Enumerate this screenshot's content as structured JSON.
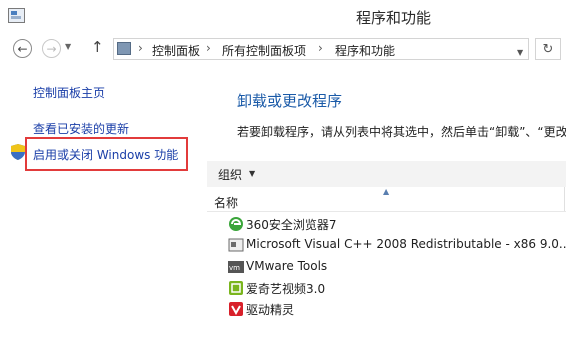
{
  "window": {
    "title": "程序和功能"
  },
  "nav": {
    "breadcrumbs": [
      "控制面板",
      "所有控制面板项",
      "程序和功能"
    ]
  },
  "left": {
    "home": "控制面板主页",
    "updates": "查看已安装的更新",
    "features": "启用或关闭 Windows 功能"
  },
  "main": {
    "title": "卸载或更改程序",
    "description": "若要卸载程序，请从列表中将其选中，然后单击“卸载”、“更改”"
  },
  "toolbar": {
    "organize": "组织"
  },
  "list": {
    "column_name": "名称",
    "items": [
      {
        "name": "360安全浏览器7",
        "icon": "360-browser-icon",
        "color": "#3aa53a"
      },
      {
        "name": "Microsoft Visual C++ 2008 Redistributable - x86 9.0...",
        "icon": "installer-icon",
        "color": "#6b6b6b"
      },
      {
        "name": "VMware Tools",
        "icon": "vmware-icon",
        "color": "#555555"
      },
      {
        "name": "爱奇艺视频3.0",
        "icon": "iqiyi-icon",
        "color": "#7ab51d"
      },
      {
        "name": "驱动精灵",
        "icon": "driver-genius-icon",
        "color": "#d8202a"
      }
    ]
  },
  "colors": {
    "highlight": "#e23b3b",
    "link": "#1a3ea8",
    "heading": "#1a5aa8"
  }
}
